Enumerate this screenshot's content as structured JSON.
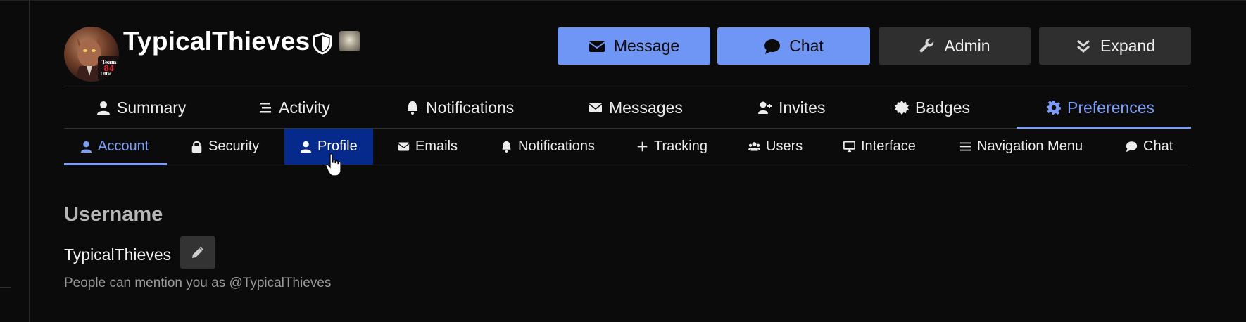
{
  "profile": {
    "username": "TypicalThieves",
    "avatar_badge": {
      "top": "Team",
      "middle": "84",
      "bottom": "Official"
    }
  },
  "header_buttons": {
    "message": "Message",
    "chat": "Chat",
    "admin": "Admin",
    "expand": "Expand"
  },
  "main_nav": {
    "items": [
      {
        "label": "Summary",
        "icon": "user-icon"
      },
      {
        "label": "Activity",
        "icon": "stream-icon"
      },
      {
        "label": "Notifications",
        "icon": "bell-icon"
      },
      {
        "label": "Messages",
        "icon": "envelope-icon"
      },
      {
        "label": "Invites",
        "icon": "user-plus-icon"
      },
      {
        "label": "Badges",
        "icon": "certificate-icon"
      },
      {
        "label": "Preferences",
        "icon": "gear-icon"
      }
    ],
    "active": "Preferences"
  },
  "sub_nav": {
    "items": [
      {
        "label": "Account",
        "icon": "user-icon"
      },
      {
        "label": "Security",
        "icon": "lock-icon"
      },
      {
        "label": "Profile",
        "icon": "user-icon"
      },
      {
        "label": "Emails",
        "icon": "envelope-icon"
      },
      {
        "label": "Notifications",
        "icon": "bell-icon"
      },
      {
        "label": "Tracking",
        "icon": "plus-icon"
      },
      {
        "label": "Users",
        "icon": "users-icon"
      },
      {
        "label": "Interface",
        "icon": "desktop-icon"
      },
      {
        "label": "Navigation Menu",
        "icon": "bars-icon"
      },
      {
        "label": "Chat",
        "icon": "comment-icon"
      }
    ],
    "current": "Account",
    "hovered": "Profile"
  },
  "content": {
    "section_title": "Username",
    "username_value": "TypicalThieves",
    "mention_hint": "People can mention you as @TypicalThieves"
  },
  "colors": {
    "background": "#0b0b0b",
    "accent": "#7d9ef7",
    "primary_button": "#6f95f5",
    "secondary_button": "#2f2f2f",
    "hover_highlight": "#062a8c"
  }
}
